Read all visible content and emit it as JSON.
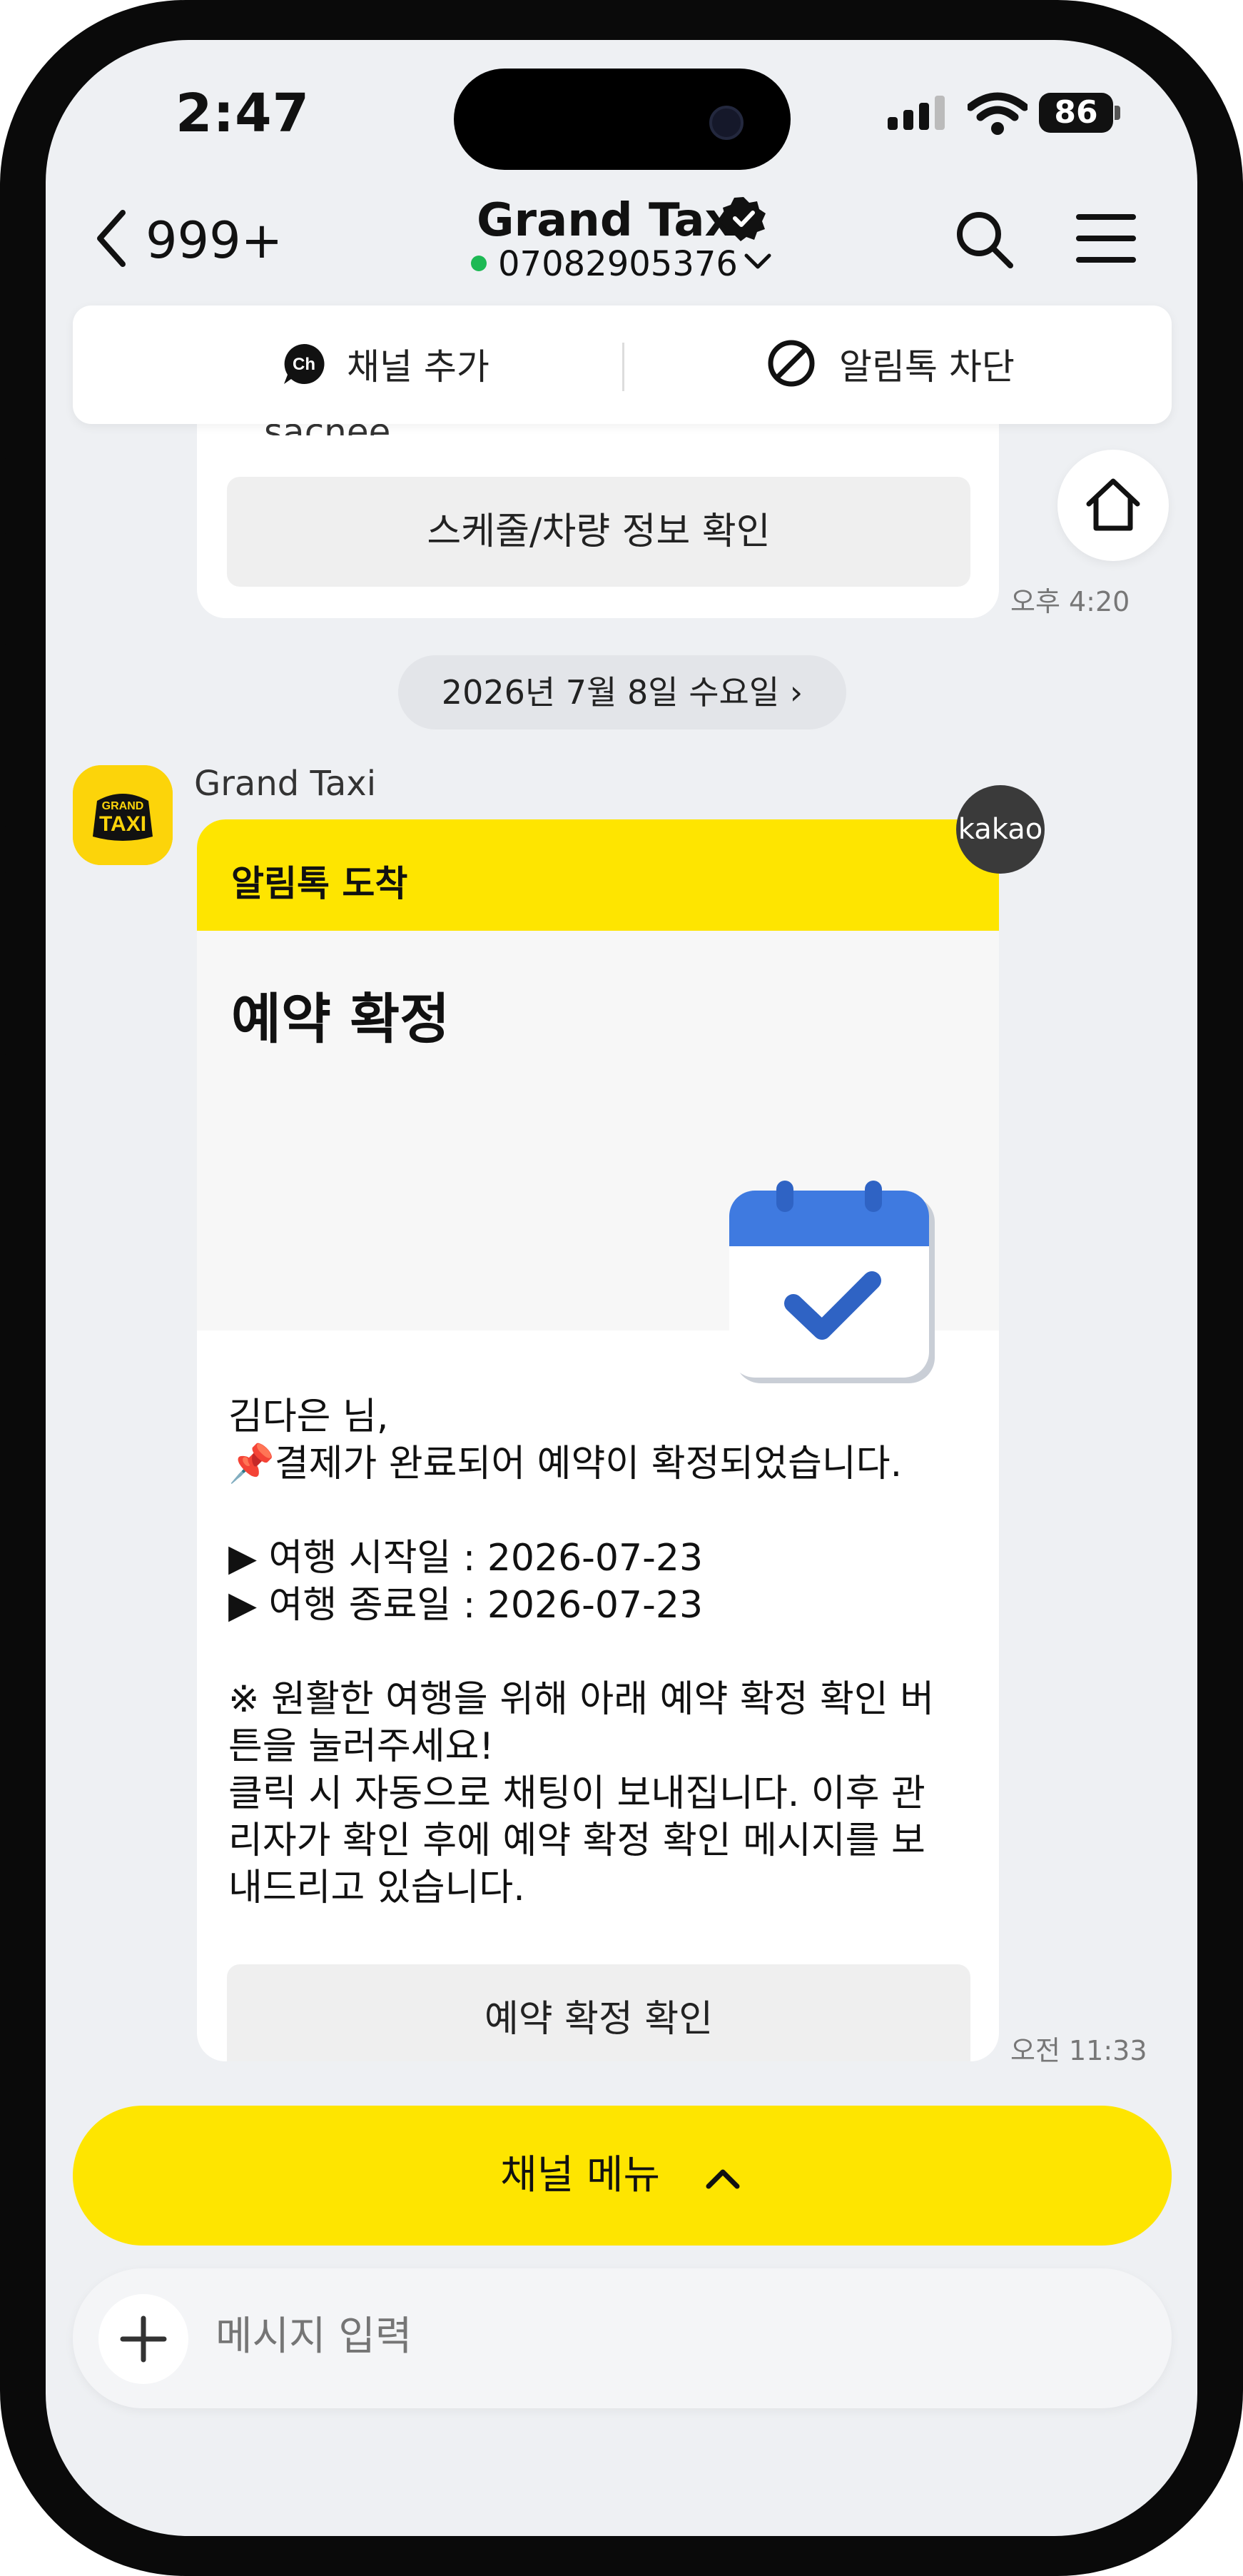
{
  "status": {
    "time": "2:47",
    "battery": "86"
  },
  "header": {
    "back_count": "999+",
    "title": "Grand Taxi",
    "phone": "07082905376"
  },
  "channel_bar": {
    "add_label": "채널 추가",
    "ch_badge": "Ch",
    "block_label": "알림톡 차단"
  },
  "prev_card": {
    "peek_text": "sacnee",
    "button_label": "스케줄/차량 정보 확인",
    "time": "오후 4:20"
  },
  "date_separator": "2026년 7월 8일 수요일 ›",
  "message": {
    "sender": "Grand Taxi",
    "avatar_text_top": "GRAND",
    "avatar_text_bottom": "TAXI",
    "badge": "kakao",
    "header_label": "알림톡 도착",
    "hero_title": "예약 확정",
    "body_lines": [
      "김다은 님,",
      "📌결제가 완료되어 예약이 확정되었습니다.",
      "",
      "▶ 여행 시작일 : 2026-07-23",
      "▶ 여행 종료일 : 2026-07-23",
      "",
      "※ 원활한 여행을 위해 아래 예약 확정 확인 버",
      "튼을 눌러주세요!",
      "클릭 시 자동으로 채팅이 보내집니다. 이후 관",
      "리자가 확인 후에 예약 확정 확인 메시지를 보",
      "내드리고 있습니다."
    ],
    "button_label": "예약 확정 확인",
    "time": "오전 11:33"
  },
  "channel_menu_label": "채널 메뉴",
  "input": {
    "placeholder": "메시지 입력"
  },
  "colors": {
    "kakao_yellow": "#fee500",
    "online_green": "#1db954",
    "calendar_blue": "#3f7ae0"
  }
}
